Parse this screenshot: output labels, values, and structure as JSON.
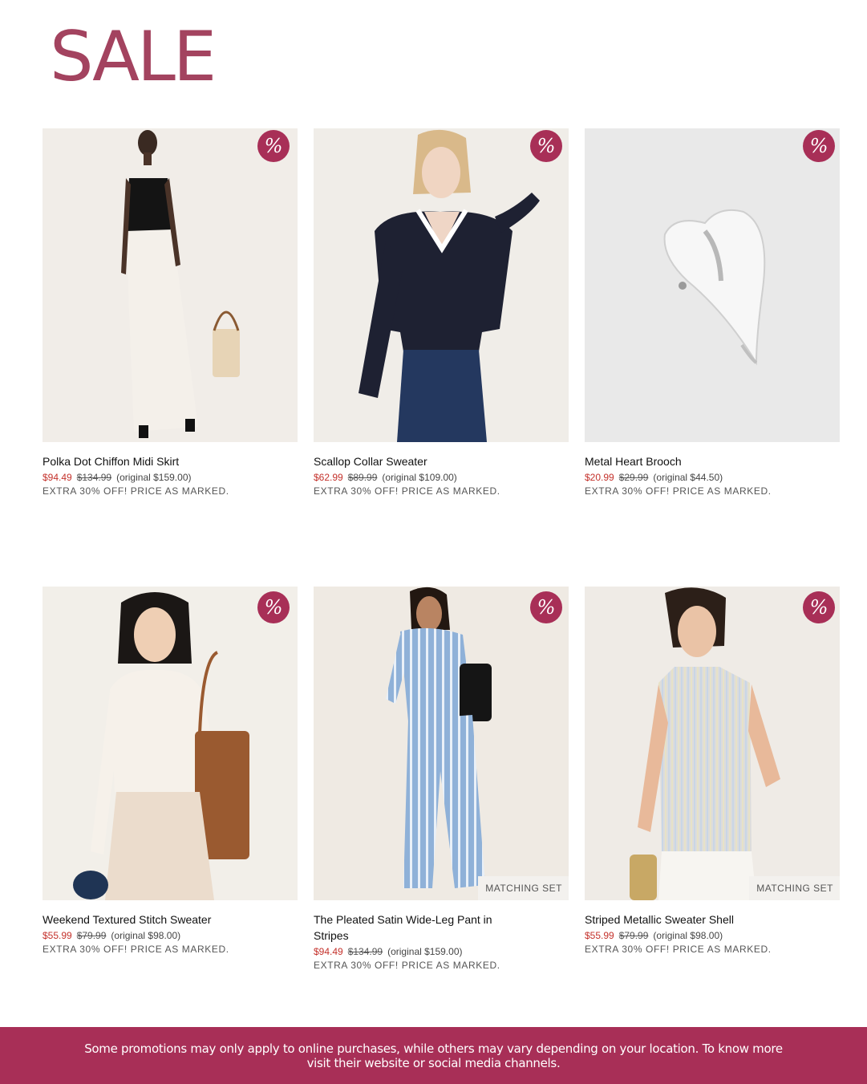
{
  "page": {
    "title": "SALE"
  },
  "badge_icon": "percent-icon",
  "badge_symbol": "%",
  "products": [
    {
      "name": "Polka Dot Chiffon Midi Skirt",
      "sale_price": "$94.49",
      "was_price": "$134.99",
      "original": "(original $159.00)",
      "promo": "EXTRA 30% OFF! PRICE AS MARKED.",
      "tag": ""
    },
    {
      "name": "Scallop Collar Sweater",
      "sale_price": "$62.99",
      "was_price": "$89.99",
      "original": "(original $109.00)",
      "promo": "EXTRA 30% OFF! PRICE AS MARKED.",
      "tag": ""
    },
    {
      "name": "Metal Heart Brooch",
      "sale_price": "$20.99",
      "was_price": "$29.99",
      "original": "(original $44.50)",
      "promo": "EXTRA 30% OFF! PRICE AS MARKED.",
      "tag": ""
    },
    {
      "name": "Weekend Textured Stitch Sweater",
      "sale_price": "$55.99",
      "was_price": "$79.99",
      "original": "(original $98.00)",
      "promo": "EXTRA 30% OFF! PRICE AS MARKED.",
      "tag": ""
    },
    {
      "name": "The Pleated Satin Wide-Leg Pant in Stripes",
      "sale_price": "$94.49",
      "was_price": "$134.99",
      "original": "(original $159.00)",
      "promo": "EXTRA 30% OFF! PRICE AS MARKED.",
      "tag": "MATCHING SET"
    },
    {
      "name": "Striped Metallic Sweater Shell",
      "sale_price": "$55.99",
      "was_price": "$79.99",
      "original": "(original $98.00)",
      "promo": "EXTRA 30% OFF! PRICE AS MARKED.",
      "tag": "MATCHING SET"
    }
  ],
  "footer": {
    "text": "Some promotions may only apply to online purchases, while others may vary depending on your location. To know more visit their website or social media channels."
  },
  "colors": {
    "accent": "#a82f57",
    "title": "#a3435f",
    "sale_price": "#c4312b"
  }
}
